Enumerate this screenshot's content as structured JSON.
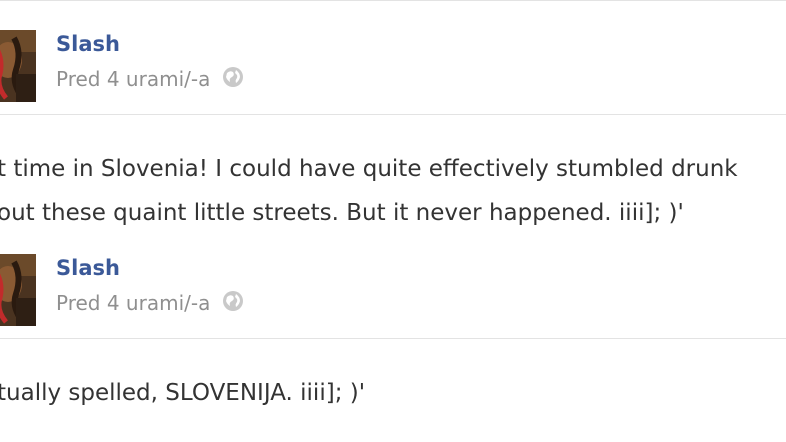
{
  "posts": [
    {
      "author": "Slash",
      "timestamp": "Pred 4 urami/-a",
      "privacy_icon": "globe-icon",
      "text_lines": [
        "t time in Slovenia! I could have quite effectively stumbled drunk",
        "out these quaint little streets. But it never happened. iiii]; )'"
      ]
    },
    {
      "author": "Slash",
      "timestamp": "Pred 4 urami/-a",
      "privacy_icon": "globe-icon",
      "text_lines": [
        "tually spelled, SLOVENIJA. iiii]; )'"
      ]
    }
  ],
  "colors": {
    "author_link": "#3b5998",
    "timestamp": "#8f8f8f",
    "body_text": "#333333",
    "divider": "#e3e3e3"
  }
}
